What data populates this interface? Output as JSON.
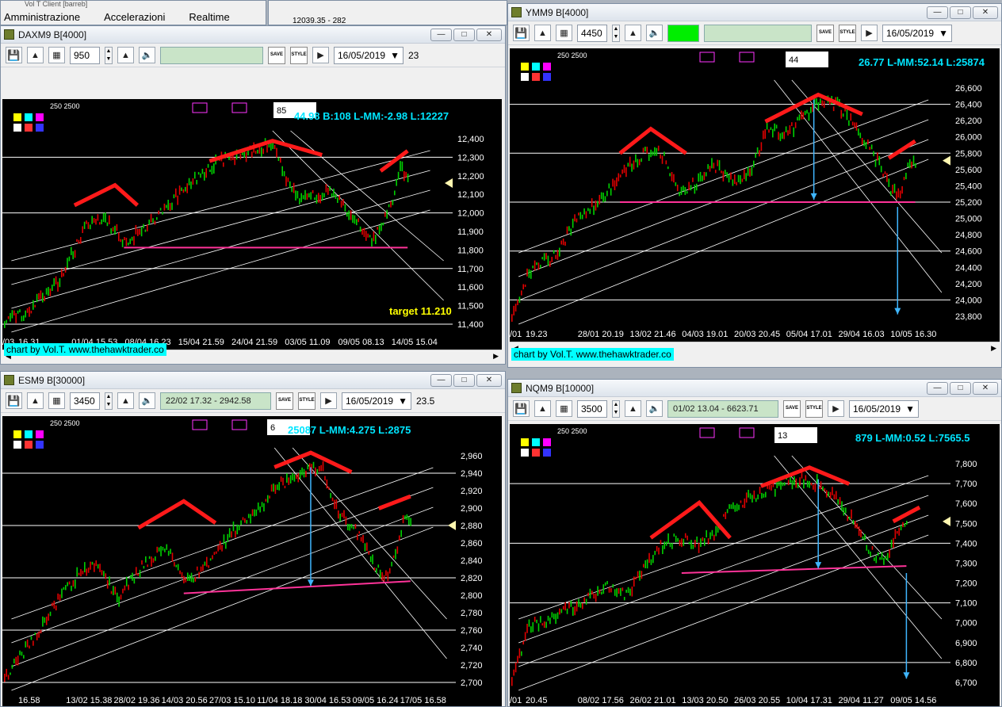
{
  "app_menu": {
    "title": "Vol T Client [barreb]",
    "items": [
      "Amministrazione",
      "Accelerazioni",
      "Realtime"
    ]
  },
  "bg_window": {
    "text": "12039.35 - 282"
  },
  "credit": "chart by Vol.T. www.thehawktrader.co",
  "panels": [
    {
      "id": "dax",
      "title": "DAXM9 B[4000]",
      "qty": "950",
      "green_text": "",
      "date": "16/05/2019",
      "date_extra": "23",
      "box_value": "85",
      "info": "44.98 B:108 L-MM:-2.98 L:12227",
      "target": "target 11.210",
      "y_labels": [
        "12,400",
        "12,300",
        "12,200",
        "12,100",
        "12,000",
        "11,900",
        "11,800",
        "11,700",
        "11,600",
        "11,500",
        "11,400"
      ],
      "x_labels": [
        "16.31",
        "01/04 15.53",
        "08/04 16.23",
        "15/04 21.59",
        "24/04 21.59",
        "03/05 11.09",
        "09/05 08.13",
        "14/05 15.04"
      ],
      "x_left": "/03"
    },
    {
      "id": "ym",
      "title": "YMM9 B[4000]",
      "qty": "4450",
      "green_text": "",
      "date": "16/05/2019",
      "date_extra": "",
      "box_value": "44",
      "info": "26.77 L-MM:52.14 L:25874",
      "y_labels": [
        "26,600",
        "26,400",
        "26,200",
        "26,000",
        "25,800",
        "25,600",
        "25,400",
        "25,200",
        "25,000",
        "24,800",
        "24,600",
        "24,400",
        "24,200",
        "24,000",
        "23,800"
      ],
      "x_labels": [
        "19.23",
        "28/01 20.19",
        "13/02 21.46",
        "04/03 19.01",
        "20/03 20.45",
        "05/04 17.01",
        "29/04 16.03",
        "10/05 16.30"
      ],
      "x_left": "/01"
    },
    {
      "id": "es",
      "title": "ESM9 B[30000]",
      "qty": "3450",
      "green_text": "22/02 17.32 - 2942.58",
      "date": "16/05/2019",
      "date_extra": "23.5",
      "box_value": "6",
      "info": "25087 L-MM:4.275 L:2875",
      "y_labels": [
        "2,960",
        "2,940",
        "2,920",
        "2,900",
        "2,880",
        "2,860",
        "2,840",
        "2,820",
        "2,800",
        "2,780",
        "2,760",
        "2,740",
        "2,720",
        "2,700"
      ],
      "x_labels": [
        "16.58",
        "13/02 15.38",
        "28/02 19.36",
        "14/03 20.56",
        "27/03 15.10",
        "11/04 18.18",
        "30/04 16.53",
        "09/05 16.24",
        "17/05 16.58"
      ],
      "x_left": ""
    },
    {
      "id": "nq",
      "title": "NQM9 B[10000]",
      "qty": "3500",
      "green_text": "01/02 13.04 - 6623.71",
      "date": "16/05/2019",
      "date_extra": "",
      "box_value": "13",
      "info": "879 L-MM:0.52 L:7565.5",
      "y_labels": [
        "7,800",
        "7,700",
        "7,600",
        "7,500",
        "7,400",
        "7,300",
        "7,200",
        "7,100",
        "7,000",
        "6,900",
        "6,800",
        "6,700"
      ],
      "x_labels": [
        "20.45",
        "08/02 17.56",
        "26/02 21.01",
        "13/03 20.50",
        "26/03 20.55",
        "10/04 17.31",
        "29/04 11.27",
        "09/05 14.56"
      ],
      "x_left": "/01"
    }
  ],
  "colors": {
    "up": "#00d000",
    "down": "#e00000",
    "pattern": "#ff1a1a",
    "support": "#ff3399",
    "arrow": "#3fb6ff",
    "label": "#00e5ff",
    "target": "#ffff00"
  }
}
